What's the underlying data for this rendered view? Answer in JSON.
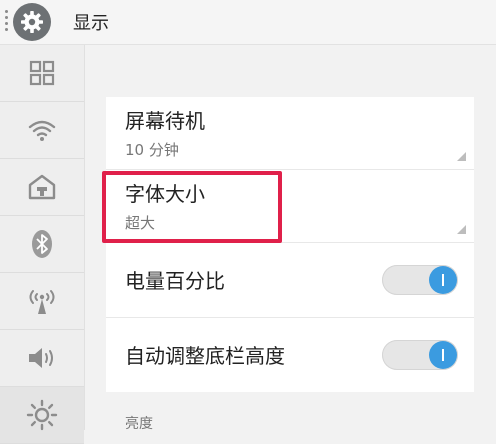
{
  "header": {
    "title": "显示",
    "icon": "gear-icon"
  },
  "sidebar": {
    "items": [
      {
        "name": "apps-grid-icon"
      },
      {
        "name": "wifi-icon"
      },
      {
        "name": "home-icon"
      },
      {
        "name": "bluetooth-icon"
      },
      {
        "name": "hotspot-icon"
      },
      {
        "name": "volume-icon"
      },
      {
        "name": "brightness-icon",
        "active": true
      }
    ]
  },
  "settings": {
    "screen_timeout": {
      "label": "屏幕待机",
      "value": "10 分钟"
    },
    "font_size": {
      "label": "字体大小",
      "value": "超大"
    },
    "battery_percent": {
      "label": "电量百分比",
      "enabled": true
    },
    "auto_bar_height": {
      "label": "自动调整底栏高度",
      "enabled": true
    }
  },
  "section": {
    "brightness_label": "亮度"
  },
  "colors": {
    "accent": "#3b9be0",
    "highlight": "#e0204a"
  }
}
